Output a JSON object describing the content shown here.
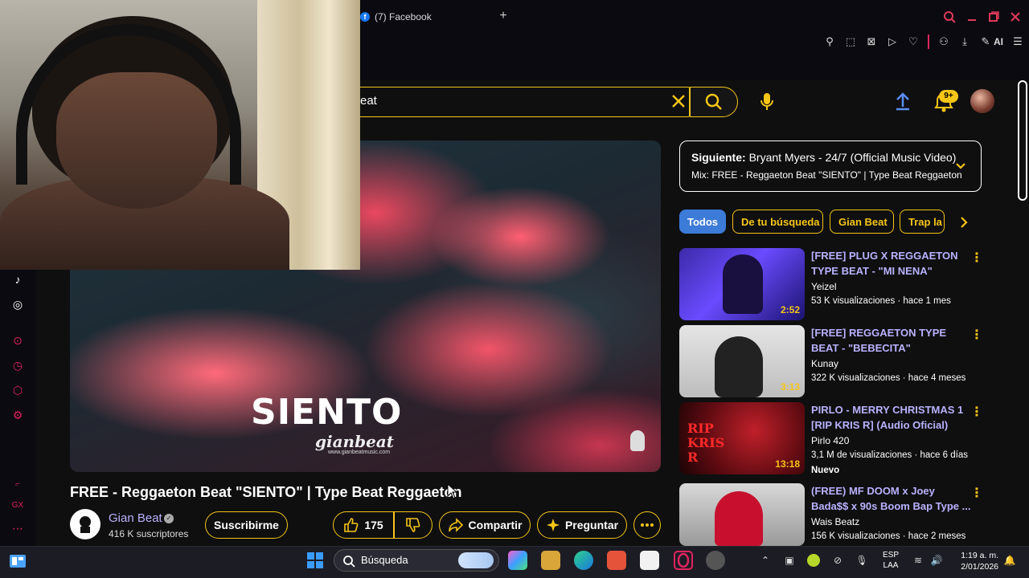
{
  "browser": {
    "tab_label": "(7) Facebook",
    "tab_favicon": "facebook-icon",
    "new_tab": "+",
    "ai_label": "AI"
  },
  "header": {
    "search_value": "eat",
    "notification_count": "9+"
  },
  "player": {
    "overlay_title": "SIENTO",
    "overlay_brand": "gianbeat",
    "overlay_url": "www.gianbeatmusic.com"
  },
  "video": {
    "title": "FREE - Reggaeton Beat \"SIENTO\" | Type Beat Reggaeton",
    "channel_name": "Gian Beat",
    "subscribers": "416 K suscriptores",
    "subscribe_label": "Suscribirme",
    "like_count": "175",
    "share_label": "Compartir",
    "ask_label": "Preguntar"
  },
  "nextup": {
    "prefix": "Siguiente:",
    "title": "Bryant Myers - 24/7 (Official Music Video)",
    "mix": "Mix: FREE - Reggaeton Beat \"SIENTO\" | Type Beat Reggaeton"
  },
  "chips": [
    "Todos",
    "De tu búsqueda",
    "Gian Beat",
    "Trap la"
  ],
  "recommendations": [
    {
      "title": "[FREE] PLUG X REGGAETON TYPE BEAT - \"MI NENA\"",
      "channel": "Yeizel",
      "meta": "53 K visualizaciones · hace 1 mes",
      "duration": "2:52",
      "badge": ""
    },
    {
      "title": "[FREE] REGGAETON TYPE BEAT - \"BEBECITA\"",
      "channel": "Kunay",
      "meta": "322 K visualizaciones · hace 4 meses",
      "duration": "3:13",
      "badge": ""
    },
    {
      "title": "PIRLO - MERRY CHRISTMAS 1 [RIP KRIS R] (Audio Oficial)",
      "channel": "Pirlo 420",
      "meta": "3,1 M de visualizaciones · hace 6 días",
      "duration": "13:18",
      "badge": "Nuevo",
      "thumb_text": "RIP KRIS R"
    },
    {
      "title": "(FREE) MF DOOM x Joey Bada$$ x 90s Boom Bap Type ...",
      "channel": "Wais Beatz",
      "meta": "156 K visualizaciones · hace 2 meses",
      "duration": "",
      "badge": ""
    }
  ],
  "taskbar": {
    "search_label": "Búsqueda",
    "lang_line1": "ESP",
    "lang_line2": "LAA",
    "time": "1:19 a. m.",
    "date": "2/01/2026"
  },
  "colors": {
    "accent_yellow": "#f5c518",
    "accent_pink": "#e0245e",
    "link_purple": "#b9b2ff",
    "chip_active": "#3d7bd9"
  }
}
